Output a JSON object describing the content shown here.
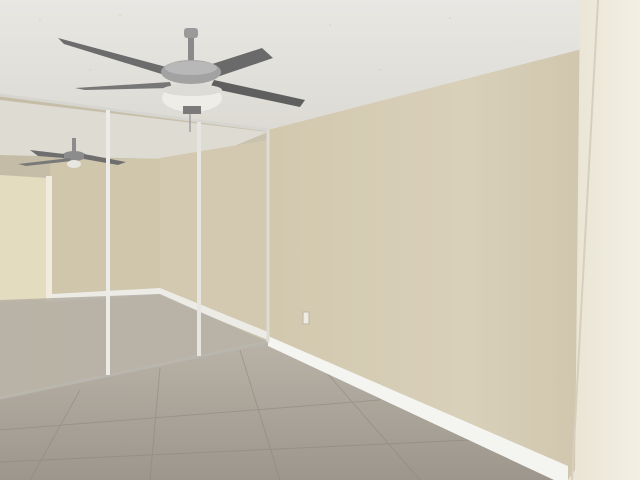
{
  "scene": {
    "subject": "empty-room-interior",
    "colors": {
      "ceiling": "#e3e1dc",
      "wall": "#d8cfb8",
      "wall_shadow": "#c9bfa6",
      "floor": "#a9a39a",
      "floor_light": "#bdb7ad",
      "baseboard": "#f2f2ef",
      "mirror": "#c7c2b6",
      "door_frame": "#ece6d6",
      "fan_metal": "#8f8f8f",
      "fan_blade": "#6b6b6b"
    },
    "objects": [
      {
        "name": "ceiling-fan",
        "icon": "ceiling-fan-icon"
      },
      {
        "name": "mirrored-closet-doors",
        "panels": 3
      },
      {
        "name": "tile-floor"
      },
      {
        "name": "baseboard"
      },
      {
        "name": "door-frame"
      }
    ]
  }
}
